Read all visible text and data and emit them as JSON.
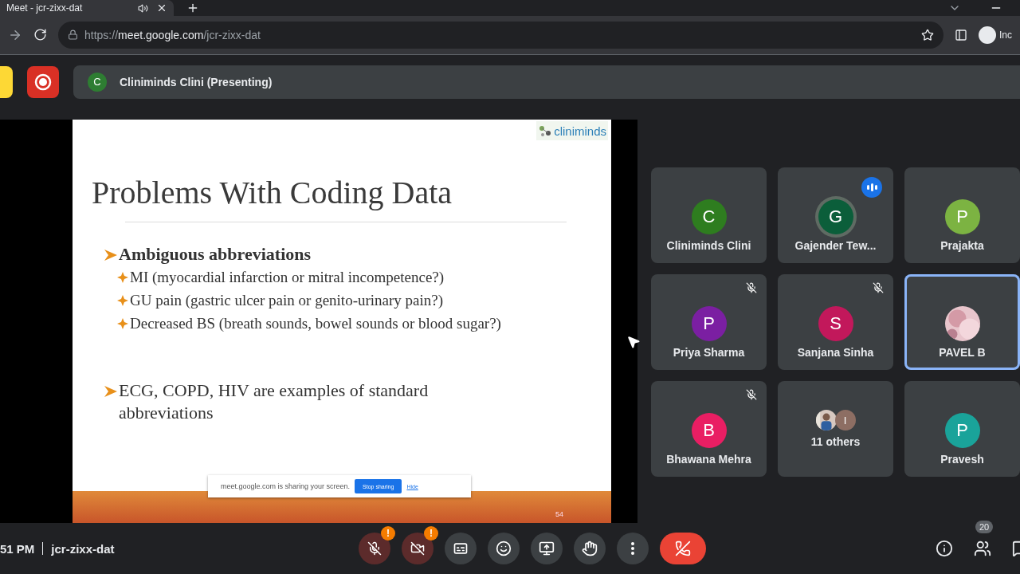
{
  "browser": {
    "tab": {
      "title": "Meet - jcr-zixx-dat",
      "audio_playing": true
    },
    "url": {
      "scheme": "https://",
      "host": "meet.google.com",
      "path": "/jcr-zixx-dat"
    },
    "profile_label": "Inc"
  },
  "meet_header": {
    "presenter_initial": "C",
    "presenter_label": "Cliniminds Clini (Presenting)",
    "recording": true
  },
  "slide": {
    "logo": "cliniminds",
    "title": "Problems With Coding Data",
    "sections": [
      {
        "heading": "Ambiguous abbreviations",
        "bold": true,
        "items": [
          "MI (myocardial infarction or mitral incompetence?)",
          "GU pain (gastric ulcer pain or genito-urinary pain?)",
          "Decreased BS (breath sounds, bowel sounds or blood sugar?)"
        ]
      },
      {
        "heading": "ECG, COPD, HIV are examples of standard abbreviations",
        "bold": false
      }
    ],
    "page_number": "54"
  },
  "share_banner": {
    "text": "meet.google.com is sharing your screen.",
    "stop_button": "Stop sharing",
    "hide_link": "Hide"
  },
  "participants": [
    {
      "kind": "avatar",
      "name": "Cliniminds Clini",
      "initial": "C",
      "color": "#2e7d1f",
      "muted": false,
      "speaking": false,
      "selected": false
    },
    {
      "kind": "avatar",
      "name": "Gajender Tew...",
      "initial": "G",
      "color": "#0b5e3a",
      "muted": false,
      "speaking": true,
      "selected": false
    },
    {
      "kind": "avatar",
      "name": "Prajakta",
      "initial": "P",
      "color": "#7cb342",
      "muted": false,
      "speaking": false,
      "selected": false
    },
    {
      "kind": "avatar",
      "name": "Priya Sharma",
      "initial": "P",
      "color": "#7b1fa2",
      "muted": true,
      "speaking": false,
      "selected": false
    },
    {
      "kind": "avatar",
      "name": "Sanjana Sinha",
      "initial": "S",
      "color": "#c2185b",
      "muted": true,
      "speaking": false,
      "selected": false
    },
    {
      "name": "PAVEL B",
      "muted": false,
      "speaking": false,
      "selected": true
    },
    {
      "kind": "avatar",
      "name": "Bhawana Mehra",
      "initial": "B",
      "color": "#e91e63",
      "muted": true,
      "speaking": false,
      "selected": false
    },
    {
      "kind": "others",
      "name": "11 others",
      "initial": "I",
      "color": "#8d6e63",
      "muted": false,
      "speaking": false,
      "selected": false
    },
    {
      "kind": "avatar",
      "name": "Pravesh",
      "initial": "P",
      "color": "#1aa39a",
      "muted": false,
      "speaking": false,
      "selected": false
    }
  ],
  "bottom_bar": {
    "time": "51 PM",
    "meeting_code": "jcr-zixx-dat",
    "participant_count": "20",
    "controls": [
      {
        "kind": "mic",
        "off": true,
        "alert": "!"
      },
      {
        "kind": "camera",
        "off": true,
        "alert": "!"
      },
      {
        "kind": "captions",
        "off": false
      },
      {
        "kind": "emoji",
        "off": false
      },
      {
        "kind": "present",
        "off": false
      },
      {
        "kind": "hand",
        "off": false
      },
      {
        "kind": "more",
        "off": false
      },
      {
        "kind": "leave"
      }
    ]
  }
}
